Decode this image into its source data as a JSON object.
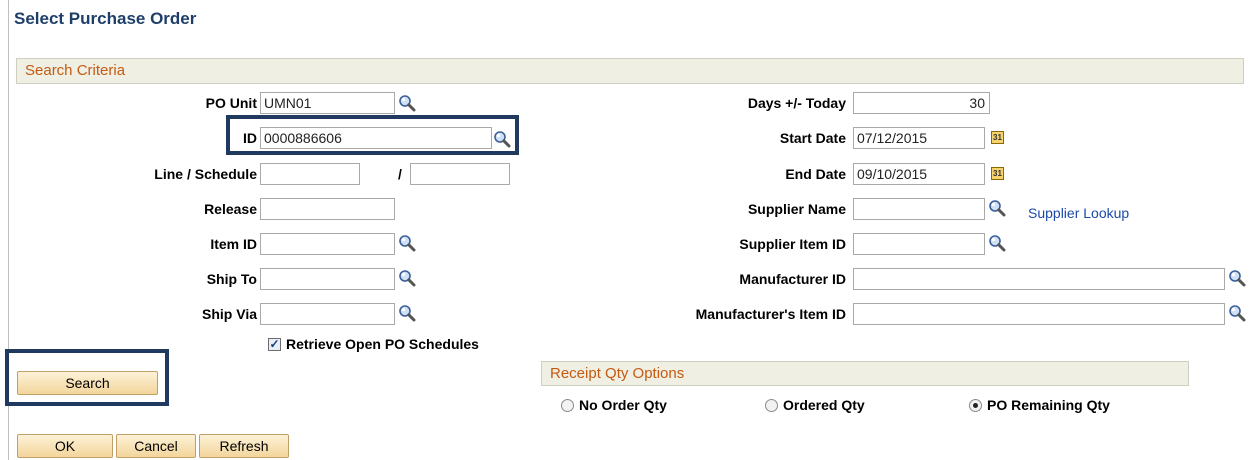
{
  "page": {
    "title": "Select Purchase Order"
  },
  "search_criteria": {
    "header": "Search Criteria",
    "po_unit": {
      "label": "PO Unit",
      "value": "UMN01"
    },
    "id": {
      "label": "ID",
      "value": "0000886606"
    },
    "line_schedule": {
      "label": "Line / Schedule",
      "separator": "/",
      "line_value": "",
      "schedule_value": ""
    },
    "release": {
      "label": "Release",
      "value": ""
    },
    "item_id": {
      "label": "Item ID",
      "value": ""
    },
    "ship_to": {
      "label": "Ship To",
      "value": ""
    },
    "ship_via": {
      "label": "Ship Via",
      "value": ""
    },
    "retrieve_open": {
      "label": "Retrieve Open PO Schedules",
      "checked": true
    },
    "days_today": {
      "label": "Days +/- Today",
      "value": "30"
    },
    "start_date": {
      "label": "Start Date",
      "value": "07/12/2015"
    },
    "end_date": {
      "label": "End Date",
      "value": "09/10/2015"
    },
    "supplier_name": {
      "label": "Supplier Name",
      "value": ""
    },
    "supplier_lookup": "Supplier Lookup",
    "supplier_item_id": {
      "label": "Supplier Item ID",
      "value": ""
    },
    "manufacturer_id": {
      "label": "Manufacturer ID",
      "value": ""
    },
    "manufacturers_item_id": {
      "label": "Manufacturer's Item ID",
      "value": ""
    }
  },
  "search_button": "Search",
  "receipt_qty": {
    "header": "Receipt Qty Options",
    "options": [
      {
        "label": "No Order Qty",
        "selected": false
      },
      {
        "label": "Ordered Qty",
        "selected": false
      },
      {
        "label": "PO Remaining Qty",
        "selected": true
      }
    ]
  },
  "footer": {
    "ok": "OK",
    "cancel": "Cancel",
    "refresh": "Refresh"
  },
  "icons": {
    "lookup": "magnifier-icon",
    "calendar": "calendar-icon"
  },
  "colors": {
    "title": "#1f3f6b",
    "section_text": "#c55a11",
    "highlight_border": "#20395f",
    "button": "#f3d59a",
    "link": "#1b4aa8"
  }
}
